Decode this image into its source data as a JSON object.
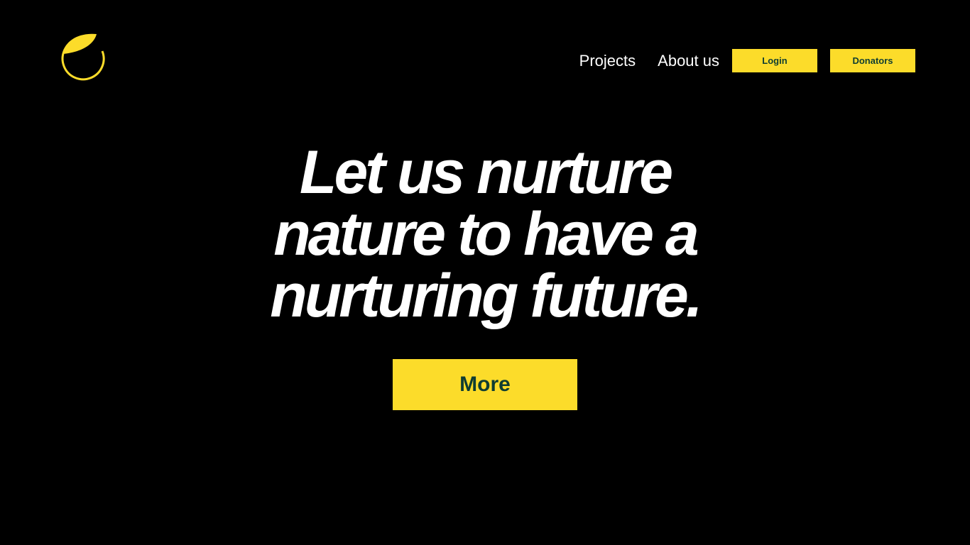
{
  "brand": {
    "logo_icon": "leaf-circle-icon",
    "accent_color": "#fcdc2a",
    "text_dark_color": "#0f3d32"
  },
  "nav": {
    "links": [
      "Projects",
      "About us"
    ],
    "login_label": "Login",
    "donators_label": "Donators"
  },
  "hero": {
    "headline_lines": [
      "Let us nurture",
      "nature to have a",
      "nurturing future."
    ],
    "cta_label": "More"
  }
}
